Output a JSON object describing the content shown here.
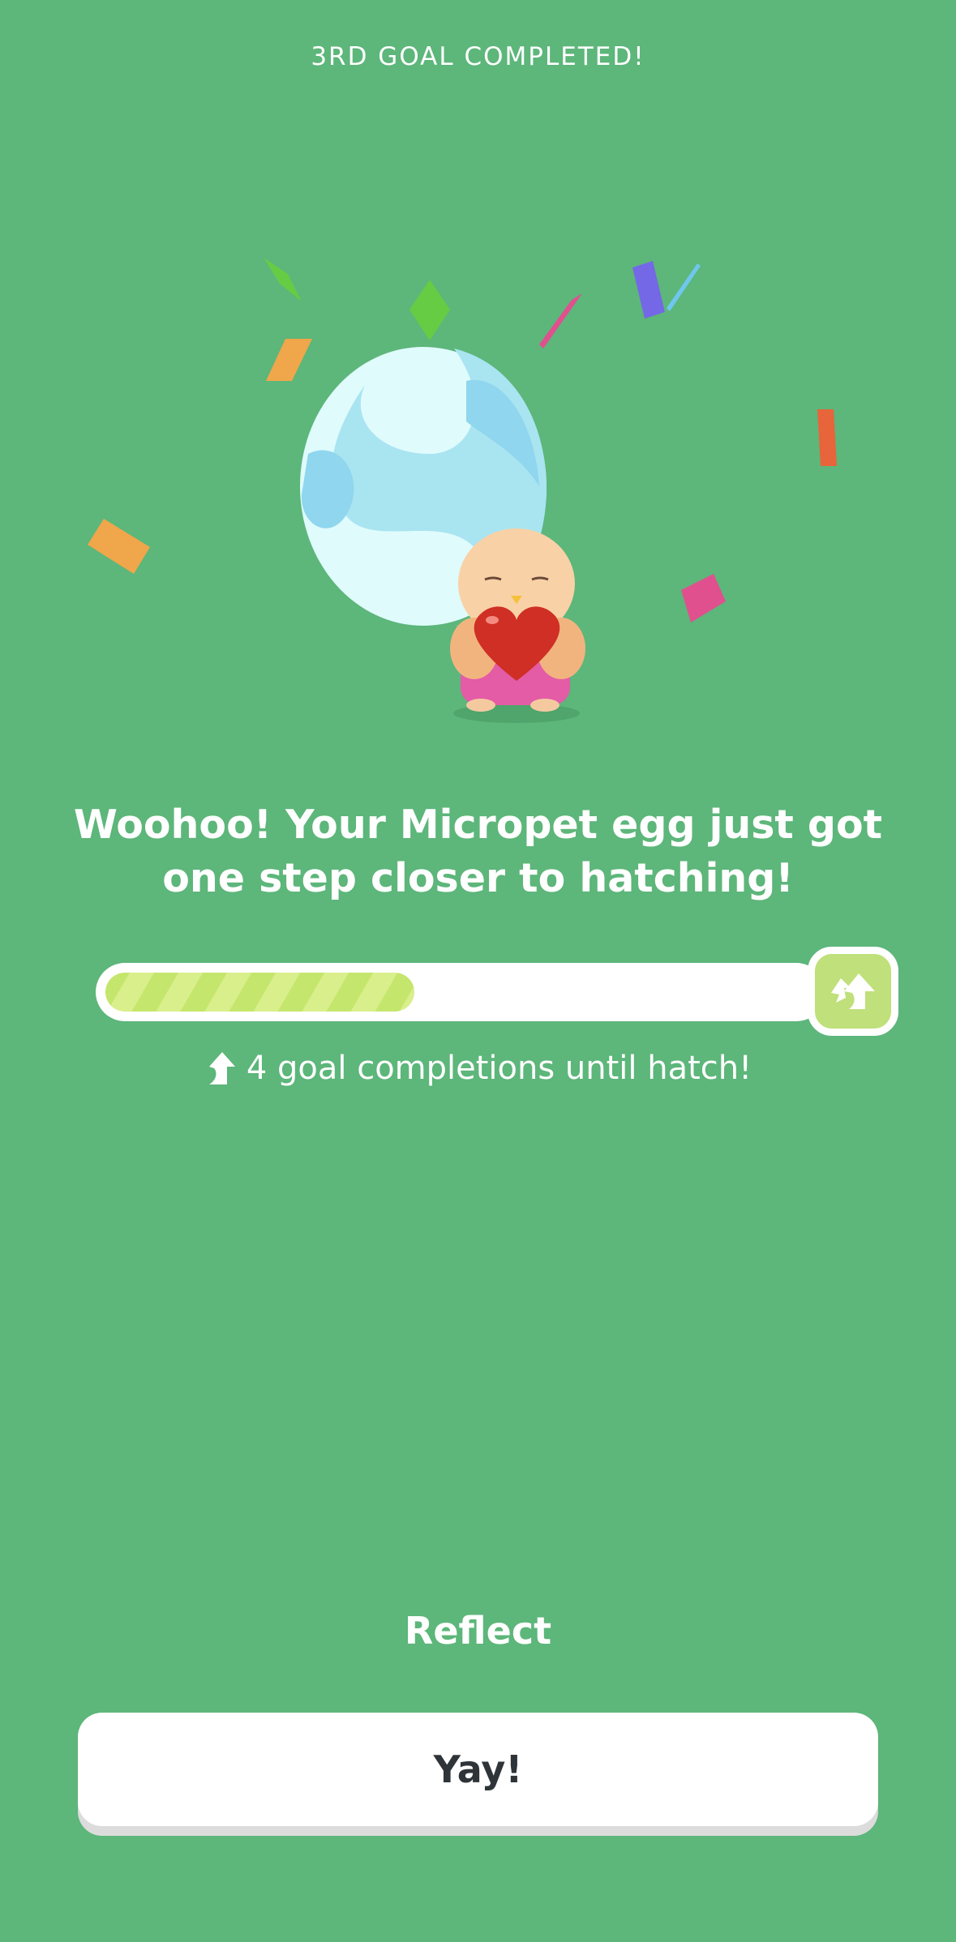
{
  "header": {
    "goal_label": "3RD GOAL COMPLETED!"
  },
  "hero": {
    "egg_icon": "pet-egg",
    "pet_icon": "micropet-holding-heart"
  },
  "message": {
    "headline": "Woohoo! Your Micropet egg just got one step closer to hatching!"
  },
  "progress": {
    "fraction_filled": 0.3,
    "badge_icon": "hatch-arrows-icon",
    "remaining_text": "4 goal completions until hatch!"
  },
  "actions": {
    "reflect_label": "Reflect",
    "primary_label": "Yay!"
  },
  "colors": {
    "background": "#5db67a",
    "progress_fill": "#c5e66c",
    "badge": "#bfe07a",
    "button": "#ffffff",
    "button_text": "#2f3438"
  }
}
